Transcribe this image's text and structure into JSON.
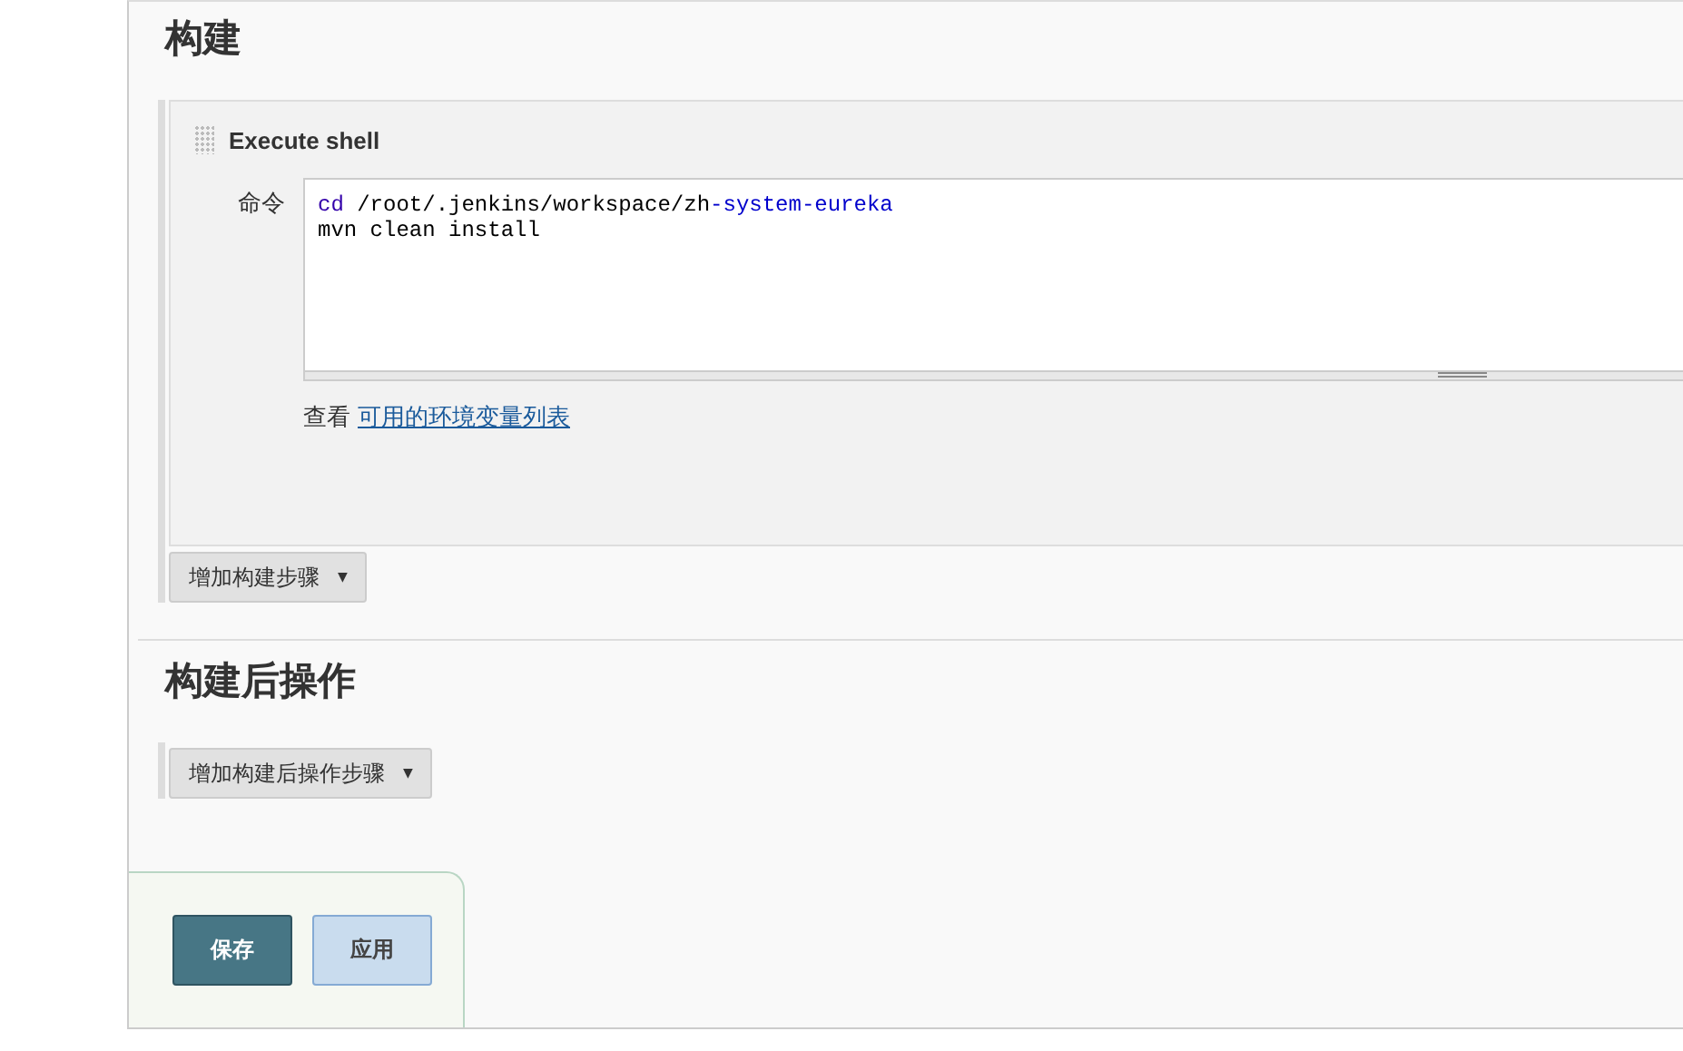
{
  "build": {
    "title": "构建",
    "step": {
      "title": "Execute shell",
      "field_label": "命令",
      "command_lines": [
        [
          {
            "text": "cd",
            "color": "#3300aa"
          },
          {
            "text": " /root/.jenkins/workspace/zh",
            "color": "#000000"
          },
          {
            "text": "-system-eureka",
            "color": "#0000cc"
          }
        ],
        [
          {
            "text": "mvn clean install",
            "color": "#000000"
          }
        ]
      ],
      "help_prefix": "查看",
      "help_link": "可用的环境变量列表"
    },
    "add_button": "增加构建步骤",
    "add_caret": "▼"
  },
  "post_build": {
    "title": "构建后操作",
    "add_button": "增加构建后操作步骤",
    "add_caret": "▼"
  },
  "buttons": [
    {
      "label": "保存",
      "kind": "primary"
    },
    {
      "label": "应用",
      "kind": "secondary"
    }
  ]
}
